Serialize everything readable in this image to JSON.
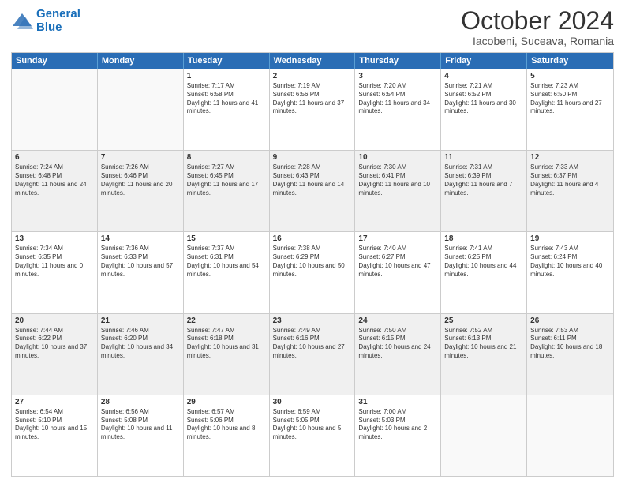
{
  "header": {
    "logo_line1": "General",
    "logo_line2": "Blue",
    "month": "October 2024",
    "location": "Iacobeni, Suceava, Romania"
  },
  "days_of_week": [
    "Sunday",
    "Monday",
    "Tuesday",
    "Wednesday",
    "Thursday",
    "Friday",
    "Saturday"
  ],
  "weeks": [
    [
      {
        "day": "",
        "info": ""
      },
      {
        "day": "",
        "info": ""
      },
      {
        "day": "1",
        "info": "Sunrise: 7:17 AM\nSunset: 6:58 PM\nDaylight: 11 hours and 41 minutes."
      },
      {
        "day": "2",
        "info": "Sunrise: 7:19 AM\nSunset: 6:56 PM\nDaylight: 11 hours and 37 minutes."
      },
      {
        "day": "3",
        "info": "Sunrise: 7:20 AM\nSunset: 6:54 PM\nDaylight: 11 hours and 34 minutes."
      },
      {
        "day": "4",
        "info": "Sunrise: 7:21 AM\nSunset: 6:52 PM\nDaylight: 11 hours and 30 minutes."
      },
      {
        "day": "5",
        "info": "Sunrise: 7:23 AM\nSunset: 6:50 PM\nDaylight: 11 hours and 27 minutes."
      }
    ],
    [
      {
        "day": "6",
        "info": "Sunrise: 7:24 AM\nSunset: 6:48 PM\nDaylight: 11 hours and 24 minutes."
      },
      {
        "day": "7",
        "info": "Sunrise: 7:26 AM\nSunset: 6:46 PM\nDaylight: 11 hours and 20 minutes."
      },
      {
        "day": "8",
        "info": "Sunrise: 7:27 AM\nSunset: 6:45 PM\nDaylight: 11 hours and 17 minutes."
      },
      {
        "day": "9",
        "info": "Sunrise: 7:28 AM\nSunset: 6:43 PM\nDaylight: 11 hours and 14 minutes."
      },
      {
        "day": "10",
        "info": "Sunrise: 7:30 AM\nSunset: 6:41 PM\nDaylight: 11 hours and 10 minutes."
      },
      {
        "day": "11",
        "info": "Sunrise: 7:31 AM\nSunset: 6:39 PM\nDaylight: 11 hours and 7 minutes."
      },
      {
        "day": "12",
        "info": "Sunrise: 7:33 AM\nSunset: 6:37 PM\nDaylight: 11 hours and 4 minutes."
      }
    ],
    [
      {
        "day": "13",
        "info": "Sunrise: 7:34 AM\nSunset: 6:35 PM\nDaylight: 11 hours and 0 minutes."
      },
      {
        "day": "14",
        "info": "Sunrise: 7:36 AM\nSunset: 6:33 PM\nDaylight: 10 hours and 57 minutes."
      },
      {
        "day": "15",
        "info": "Sunrise: 7:37 AM\nSunset: 6:31 PM\nDaylight: 10 hours and 54 minutes."
      },
      {
        "day": "16",
        "info": "Sunrise: 7:38 AM\nSunset: 6:29 PM\nDaylight: 10 hours and 50 minutes."
      },
      {
        "day": "17",
        "info": "Sunrise: 7:40 AM\nSunset: 6:27 PM\nDaylight: 10 hours and 47 minutes."
      },
      {
        "day": "18",
        "info": "Sunrise: 7:41 AM\nSunset: 6:25 PM\nDaylight: 10 hours and 44 minutes."
      },
      {
        "day": "19",
        "info": "Sunrise: 7:43 AM\nSunset: 6:24 PM\nDaylight: 10 hours and 40 minutes."
      }
    ],
    [
      {
        "day": "20",
        "info": "Sunrise: 7:44 AM\nSunset: 6:22 PM\nDaylight: 10 hours and 37 minutes."
      },
      {
        "day": "21",
        "info": "Sunrise: 7:46 AM\nSunset: 6:20 PM\nDaylight: 10 hours and 34 minutes."
      },
      {
        "day": "22",
        "info": "Sunrise: 7:47 AM\nSunset: 6:18 PM\nDaylight: 10 hours and 31 minutes."
      },
      {
        "day": "23",
        "info": "Sunrise: 7:49 AM\nSunset: 6:16 PM\nDaylight: 10 hours and 27 minutes."
      },
      {
        "day": "24",
        "info": "Sunrise: 7:50 AM\nSunset: 6:15 PM\nDaylight: 10 hours and 24 minutes."
      },
      {
        "day": "25",
        "info": "Sunrise: 7:52 AM\nSunset: 6:13 PM\nDaylight: 10 hours and 21 minutes."
      },
      {
        "day": "26",
        "info": "Sunrise: 7:53 AM\nSunset: 6:11 PM\nDaylight: 10 hours and 18 minutes."
      }
    ],
    [
      {
        "day": "27",
        "info": "Sunrise: 6:54 AM\nSunset: 5:10 PM\nDaylight: 10 hours and 15 minutes."
      },
      {
        "day": "28",
        "info": "Sunrise: 6:56 AM\nSunset: 5:08 PM\nDaylight: 10 hours and 11 minutes."
      },
      {
        "day": "29",
        "info": "Sunrise: 6:57 AM\nSunset: 5:06 PM\nDaylight: 10 hours and 8 minutes."
      },
      {
        "day": "30",
        "info": "Sunrise: 6:59 AM\nSunset: 5:05 PM\nDaylight: 10 hours and 5 minutes."
      },
      {
        "day": "31",
        "info": "Sunrise: 7:00 AM\nSunset: 5:03 PM\nDaylight: 10 hours and 2 minutes."
      },
      {
        "day": "",
        "info": ""
      },
      {
        "day": "",
        "info": ""
      }
    ]
  ]
}
